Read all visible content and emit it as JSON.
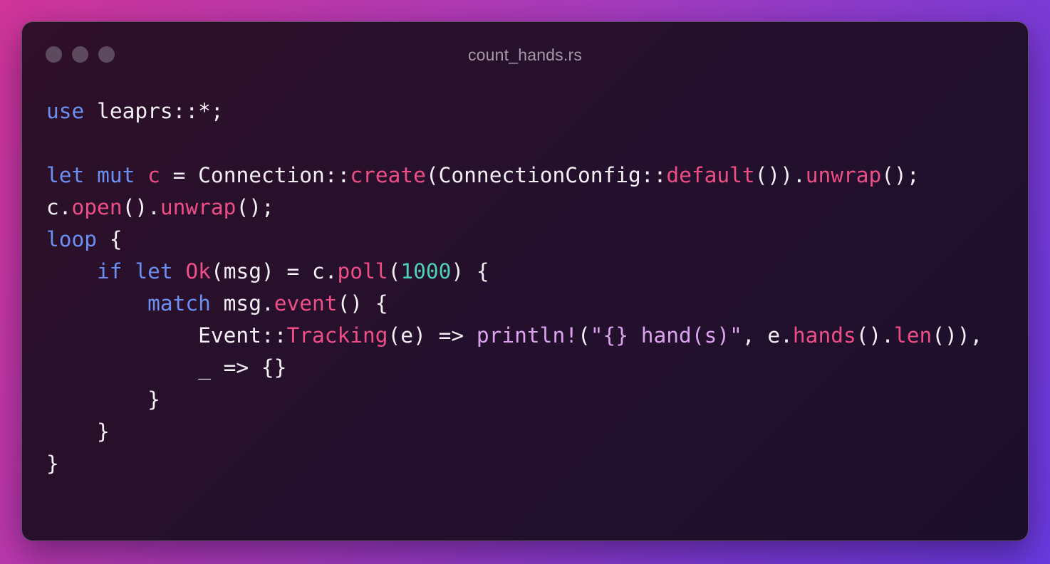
{
  "window": {
    "title": "count_hands.rs",
    "traffic_lights": [
      "close",
      "minimize",
      "zoom"
    ]
  },
  "colors": {
    "keyword": "#6c8ff2",
    "function": "#ee4d86",
    "number": "#4fd1b4",
    "macro_string": "#dca2f0",
    "text": "#f4f0f6",
    "title": "#a797a9",
    "traffic_light": "#5e4a5e"
  },
  "code": {
    "language": "rust",
    "lines": [
      [
        {
          "t": "use",
          "k": "kw"
        },
        {
          "t": " leaprs::*;",
          "k": "plain"
        }
      ],
      [],
      [
        {
          "t": "let",
          "k": "kw"
        },
        {
          "t": " ",
          "k": "plain"
        },
        {
          "t": "mut",
          "k": "kw"
        },
        {
          "t": " ",
          "k": "plain"
        },
        {
          "t": "c",
          "k": "var"
        },
        {
          "t": " = Connection::",
          "k": "plain"
        },
        {
          "t": "create",
          "k": "fn"
        },
        {
          "t": "(ConnectionConfig::",
          "k": "plain"
        },
        {
          "t": "default",
          "k": "fn"
        },
        {
          "t": "()).",
          "k": "plain"
        },
        {
          "t": "unwrap",
          "k": "fn"
        },
        {
          "t": "();",
          "k": "plain"
        }
      ],
      [
        {
          "t": "c.",
          "k": "plain"
        },
        {
          "t": "open",
          "k": "fn"
        },
        {
          "t": "().",
          "k": "plain"
        },
        {
          "t": "unwrap",
          "k": "fn"
        },
        {
          "t": "();",
          "k": "plain"
        }
      ],
      [
        {
          "t": "loop",
          "k": "kw"
        },
        {
          "t": " {",
          "k": "plain"
        }
      ],
      [
        {
          "t": "    ",
          "k": "plain"
        },
        {
          "t": "if",
          "k": "kw"
        },
        {
          "t": " ",
          "k": "plain"
        },
        {
          "t": "let",
          "k": "kw"
        },
        {
          "t": " ",
          "k": "plain"
        },
        {
          "t": "Ok",
          "k": "fn"
        },
        {
          "t": "(msg) = c.",
          "k": "plain"
        },
        {
          "t": "poll",
          "k": "fn"
        },
        {
          "t": "(",
          "k": "plain"
        },
        {
          "t": "1000",
          "k": "num"
        },
        {
          "t": ") {",
          "k": "plain"
        }
      ],
      [
        {
          "t": "        ",
          "k": "plain"
        },
        {
          "t": "match",
          "k": "kw"
        },
        {
          "t": " msg.",
          "k": "plain"
        },
        {
          "t": "event",
          "k": "fn"
        },
        {
          "t": "() {",
          "k": "plain"
        }
      ],
      [
        {
          "t": "            Event::",
          "k": "plain"
        },
        {
          "t": "Tracking",
          "k": "fn"
        },
        {
          "t": "(e) => ",
          "k": "plain"
        },
        {
          "t": "println!",
          "k": "macro"
        },
        {
          "t": "(",
          "k": "plain"
        },
        {
          "t": "\"{} hand(s)\"",
          "k": "str"
        },
        {
          "t": ", e.",
          "k": "plain"
        },
        {
          "t": "hands",
          "k": "fn"
        },
        {
          "t": "().",
          "k": "plain"
        },
        {
          "t": "len",
          "k": "fn"
        },
        {
          "t": "()),",
          "k": "plain"
        }
      ],
      [
        {
          "t": "            _ => {}",
          "k": "plain"
        }
      ],
      [
        {
          "t": "        }",
          "k": "plain"
        }
      ],
      [
        {
          "t": "    }",
          "k": "plain"
        }
      ],
      [
        {
          "t": "}",
          "k": "plain"
        }
      ]
    ]
  }
}
